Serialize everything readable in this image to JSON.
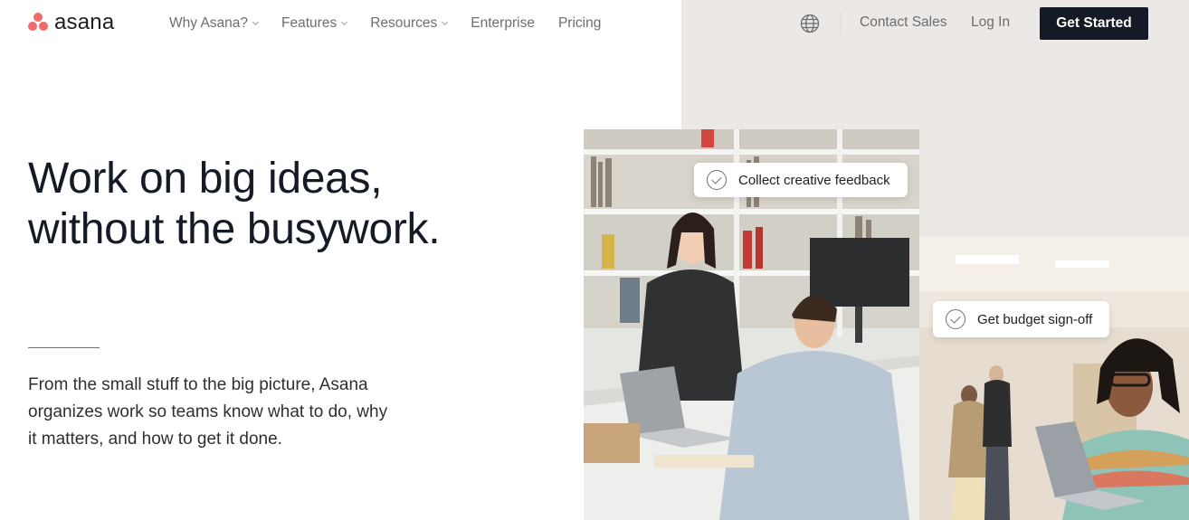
{
  "brand": {
    "name": "asana",
    "accent": "#f06a6a"
  },
  "nav": {
    "items": [
      {
        "label": "Why Asana?",
        "dropdown": true
      },
      {
        "label": "Features",
        "dropdown": true
      },
      {
        "label": "Resources",
        "dropdown": true
      },
      {
        "label": "Enterprise",
        "dropdown": false
      },
      {
        "label": "Pricing",
        "dropdown": false
      }
    ],
    "language_icon": "globe-icon",
    "contact_sales": "Contact Sales",
    "log_in": "Log In",
    "get_started": "Get Started"
  },
  "hero": {
    "headline_line1": "Work on big ideas,",
    "headline_line2": "without the busywork.",
    "subtext": "From the small stuff to the big picture, Asana organizes work so teams know what to do, why it matters, and how to get it done."
  },
  "cards": {
    "card1": "Collect creative feedback",
    "card2": "Get budget sign-off",
    "check_icon": "check-circle-icon"
  },
  "colors": {
    "cta_bg": "#151b26",
    "beige_panel": "#ebe8e6"
  }
}
